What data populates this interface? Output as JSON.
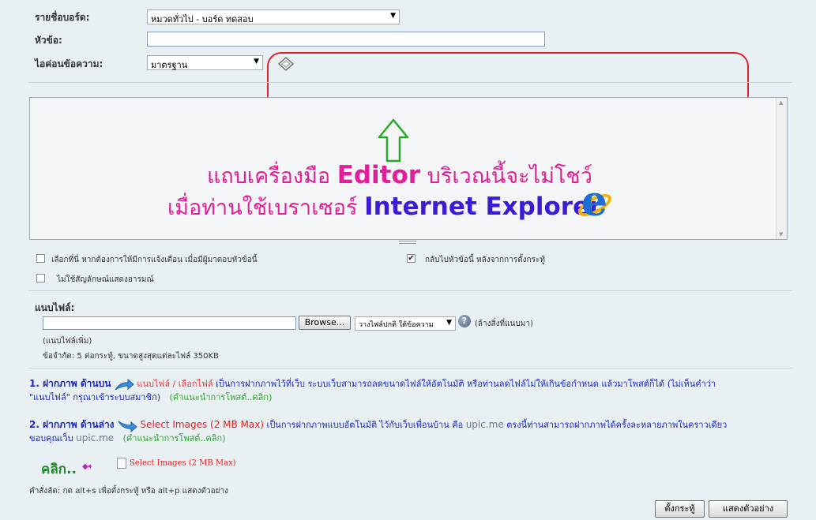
{
  "form": {
    "board_label": "รายชื่อบอร์ด:",
    "board_value": "หมวดทั่วไป - บอร์ด ทดสอบ",
    "subject_label": "หัวข้อ:",
    "subject_value": "",
    "icon_label": "ไอค่อนข้อความ:",
    "icon_value": "มาตรฐาน"
  },
  "editor_notice": {
    "line1_pre": "แถบเครื่องมือ ",
    "line1_brand": "Editor",
    "line1_post": " บริเวณนี้จะไม่โชว์",
    "line2_pre": "เมื่อท่านใช้เบราเซอร์ ",
    "line2_brand": "Internet Explorer",
    "ie_logo": "e"
  },
  "options": {
    "notify_label": "เลือกที่นี่  หากต้องการให้มีการแจ้งเตือน  เมื่อมีผู้มาตอบหัวข้อนี้",
    "return_label": "กลับไปหัวข้อนี้  หลังจากการตั้งกระทู้",
    "no_smiley_label": "ไม่ใช้สัญลักษณ์แสดงอารมณ์"
  },
  "attach": {
    "title": "แนบไฟล์:",
    "browse": "Browse...",
    "placement_value": "วางไฟล์ปกติ ใต้ข้อความ",
    "clear": "(ล้างสิ่งที่แนบมา)",
    "more": "(แนบไฟล์เพิ่ม)",
    "limits": "ข้อจำกัด: 5 ต่อกระทู้, ขนาดสูงสุดแต่ละไฟล์  350KB"
  },
  "upload1": {
    "num": "1. ฝากภาพ ด้านบน",
    "links": "แนบไฟล์  / เลือกไฟล์",
    "desc": " เป็นการฝากภาพไว้ที่เว็บ  ระบบเว็บสามารถลดขนาดไฟล์ให้อัตโนมัติ  หรือท่านลดไฟล์ไม่ให้เกินข้อกำหนด  แล้วมาโพสต์ก็ได้  (ไม่เห็นคำว่า",
    "desc2": "\"แนบไฟล์\" กรุณาเข้าระบบสมาชิก)",
    "guide": "(คำแนะนำการโพสต์..คลิก)"
  },
  "upload2": {
    "num": "2. ฝากภาพ ด้านล่าง",
    "select": "Select Images (2 MB Max)",
    "desc": " เป็นการฝากภาพแบบอัตโนมัติ   ไว้กับเว็บเพื่อนบ้าน   คือ ",
    "site": "upic.me",
    "desc_b": " ตรงนี้ท่านสามารถฝากภาพได้ครั้งละหลายภาพในคราวเดียว",
    "desc2": "ขอบคุณเว็บ ",
    "site2": "upic.me",
    "guide": "(คำแนะนำการโพสต์..คลิก)"
  },
  "click_label": "คลิก..",
  "select_images_btn": "Select Images (2 MB Max)",
  "shortcuts": "คำสั่งลัด: กด   alt+s เพื่อตั้งกระทู้   หรือ   alt+p แสดงตัวอย่าง",
  "buttons": {
    "post": "ตั้งกระทู้",
    "preview": "แสดงตัวอย่าง"
  },
  "colors": {
    "annotation_red": "#e0202a",
    "notice_pink": "#e0209a",
    "notice_blue": "#3a1bd6",
    "arrow_green": "#2aa72a"
  }
}
